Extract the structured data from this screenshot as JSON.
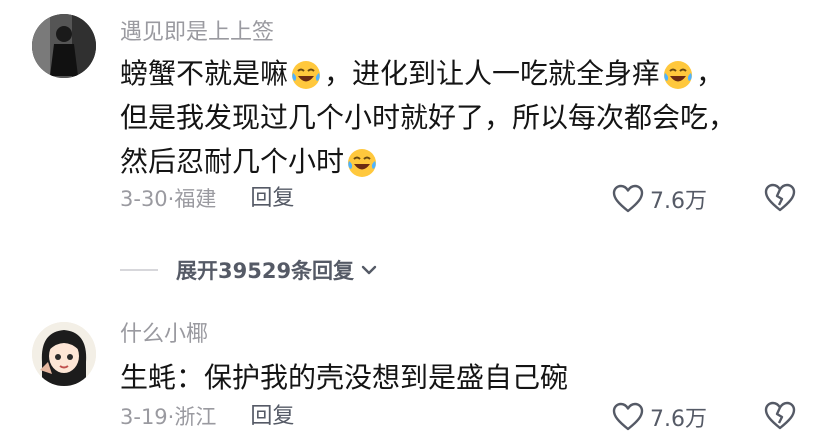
{
  "comments": [
    {
      "username": "遇见即是上上签",
      "content_lines": [
        [
          "螃蟹不就是嘛",
          "，进化到让人一吃就全身痒",
          "，"
        ],
        [
          "但是我发现过几个小时就好了，所以每次都会吃，"
        ],
        [
          "然后忍耐几个小时"
        ]
      ],
      "date_location": "3-30·福建",
      "reply_label": "回复",
      "like_count": "7.6万"
    },
    {
      "username": "什么小椰",
      "content_lines": [
        [
          "生蚝：保护我的壳没想到是盛自己碗"
        ]
      ],
      "date_location": "3-19·浙江",
      "reply_label": "回复",
      "like_count": "7.6万"
    }
  ],
  "expand_replies": "展开39529条回复",
  "icons": {
    "emoji": "laughing-crying-emoji-icon",
    "like": "heart-outline-icon",
    "dislike": "broken-heart-icon",
    "expand": "chevron-down-icon"
  }
}
